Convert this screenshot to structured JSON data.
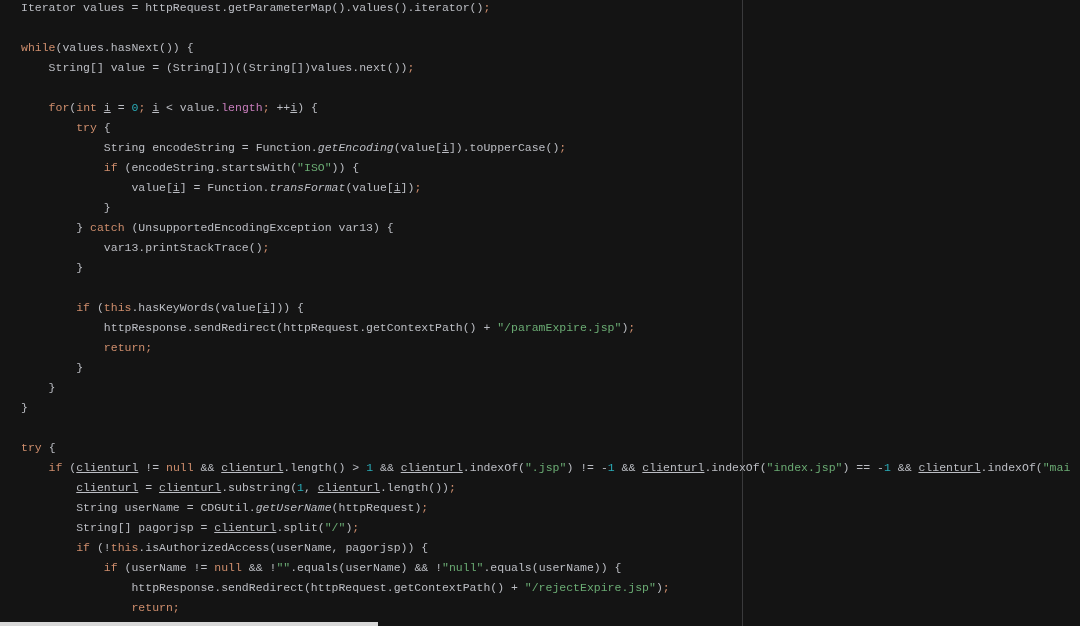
{
  "editor": {
    "lines": [
      {
        "kind": "code",
        "tokens": [
          {
            "kind": "plain",
            "t": "Iterator values = httpRequest.getParameterMap().values().iterator()"
          },
          {
            "kind": "keyword",
            "t": ";"
          }
        ]
      },
      {
        "kind": "blank"
      },
      {
        "kind": "code",
        "tokens": [
          {
            "kind": "keyword",
            "t": "while"
          },
          {
            "kind": "plain",
            "t": "(values.hasNext()) {"
          }
        ]
      },
      {
        "kind": "code",
        "tokens": [
          {
            "kind": "plain",
            "t": "    String[] value = (String[])((String[])values.next())"
          },
          {
            "kind": "keyword",
            "t": ";"
          }
        ]
      },
      {
        "kind": "blank"
      },
      {
        "kind": "code",
        "tokens": [
          {
            "kind": "keyword",
            "t": "    for"
          },
          {
            "kind": "plain",
            "t": "("
          },
          {
            "kind": "keyword",
            "t": "int "
          },
          {
            "kind": "variable",
            "t": "i"
          },
          {
            "kind": "plain",
            "t": " = "
          },
          {
            "kind": "number",
            "t": "0"
          },
          {
            "kind": "keyword",
            "t": "; "
          },
          {
            "kind": "variable",
            "t": "i"
          },
          {
            "kind": "plain",
            "t": " < value."
          },
          {
            "kind": "field",
            "t": "length"
          },
          {
            "kind": "keyword",
            "t": ";"
          },
          {
            "kind": "plain",
            "t": " ++"
          },
          {
            "kind": "variable",
            "t": "i"
          },
          {
            "kind": "plain",
            "t": ") {"
          }
        ]
      },
      {
        "kind": "code",
        "tokens": [
          {
            "kind": "keyword",
            "t": "        try"
          },
          {
            "kind": "plain",
            "t": " {"
          }
        ]
      },
      {
        "kind": "code",
        "tokens": [
          {
            "kind": "plain",
            "t": "            String encodeString = Function."
          },
          {
            "kind": "static",
            "t": "getEncoding"
          },
          {
            "kind": "plain",
            "t": "(value["
          },
          {
            "kind": "variable",
            "t": "i"
          },
          {
            "kind": "plain",
            "t": "]).toUpperCase()"
          },
          {
            "kind": "keyword",
            "t": ";"
          }
        ]
      },
      {
        "kind": "code",
        "tokens": [
          {
            "kind": "keyword",
            "t": "            if"
          },
          {
            "kind": "plain",
            "t": " (encodeString.startsWith("
          },
          {
            "kind": "string",
            "t": "\"ISO\""
          },
          {
            "kind": "plain",
            "t": ")) {"
          }
        ]
      },
      {
        "kind": "code",
        "tokens": [
          {
            "kind": "plain",
            "t": "                value["
          },
          {
            "kind": "variable",
            "t": "i"
          },
          {
            "kind": "plain",
            "t": "] = Function."
          },
          {
            "kind": "static",
            "t": "transFormat"
          },
          {
            "kind": "plain",
            "t": "(value["
          },
          {
            "kind": "variable",
            "t": "i"
          },
          {
            "kind": "plain",
            "t": "])"
          },
          {
            "kind": "keyword",
            "t": ";"
          }
        ]
      },
      {
        "kind": "code",
        "tokens": [
          {
            "kind": "plain",
            "t": "            }"
          }
        ]
      },
      {
        "kind": "code",
        "tokens": [
          {
            "kind": "plain",
            "t": "        } "
          },
          {
            "kind": "keyword",
            "t": "catch"
          },
          {
            "kind": "plain",
            "t": " (UnsupportedEncodingException var13) {"
          }
        ]
      },
      {
        "kind": "code",
        "tokens": [
          {
            "kind": "plain",
            "t": "            var13.printStackTrace()"
          },
          {
            "kind": "keyword",
            "t": ";"
          }
        ]
      },
      {
        "kind": "code",
        "tokens": [
          {
            "kind": "plain",
            "t": "        }"
          }
        ]
      },
      {
        "kind": "blank"
      },
      {
        "kind": "code",
        "tokens": [
          {
            "kind": "keyword",
            "t": "        if"
          },
          {
            "kind": "plain",
            "t": " ("
          },
          {
            "kind": "keyword",
            "t": "this"
          },
          {
            "kind": "plain",
            "t": ".hasKeyWords(value["
          },
          {
            "kind": "variable",
            "t": "i"
          },
          {
            "kind": "plain",
            "t": "])) {"
          }
        ]
      },
      {
        "kind": "code",
        "tokens": [
          {
            "kind": "plain",
            "t": "            httpResponse.sendRedirect(httpRequest.getContextPath() + "
          },
          {
            "kind": "string",
            "t": "\"/paramExpire.jsp\""
          },
          {
            "kind": "plain",
            "t": ")"
          },
          {
            "kind": "keyword",
            "t": ";"
          }
        ]
      },
      {
        "kind": "code",
        "tokens": [
          {
            "kind": "keyword",
            "t": "            return;"
          }
        ]
      },
      {
        "kind": "code",
        "tokens": [
          {
            "kind": "plain",
            "t": "        }"
          }
        ]
      },
      {
        "kind": "code",
        "tokens": [
          {
            "kind": "plain",
            "t": "    }"
          }
        ]
      },
      {
        "kind": "code",
        "tokens": [
          {
            "kind": "plain",
            "t": "}"
          }
        ]
      },
      {
        "kind": "blank"
      },
      {
        "kind": "code",
        "tokens": [
          {
            "kind": "keyword",
            "t": "try"
          },
          {
            "kind": "plain",
            "t": " {"
          }
        ]
      },
      {
        "kind": "code",
        "tokens": [
          {
            "kind": "keyword",
            "t": "    if"
          },
          {
            "kind": "plain",
            "t": " ("
          },
          {
            "kind": "variable",
            "t": "clienturl"
          },
          {
            "kind": "plain",
            "t": " != "
          },
          {
            "kind": "keyword",
            "t": "null"
          },
          {
            "kind": "plain",
            "t": " && "
          },
          {
            "kind": "variable",
            "t": "clienturl"
          },
          {
            "kind": "plain",
            "t": ".length() > "
          },
          {
            "kind": "number",
            "t": "1"
          },
          {
            "kind": "plain",
            "t": " && "
          },
          {
            "kind": "variable",
            "t": "clienturl"
          },
          {
            "kind": "plain",
            "t": ".indexOf("
          },
          {
            "kind": "string",
            "t": "\".jsp\""
          },
          {
            "kind": "plain",
            "t": ") != -"
          },
          {
            "kind": "number",
            "t": "1"
          },
          {
            "kind": "plain",
            "t": " && "
          },
          {
            "kind": "variable",
            "t": "clienturl"
          },
          {
            "kind": "plain",
            "t": ".indexOf("
          },
          {
            "kind": "string",
            "t": "\"index.jsp\""
          },
          {
            "kind": "plain",
            "t": ") == -"
          },
          {
            "kind": "number",
            "t": "1"
          },
          {
            "kind": "plain",
            "t": " && "
          },
          {
            "kind": "variable",
            "t": "clienturl"
          },
          {
            "kind": "plain",
            "t": ".indexOf("
          },
          {
            "kind": "string",
            "t": "\"mai"
          }
        ]
      },
      {
        "kind": "code",
        "tokens": [
          {
            "kind": "variable",
            "t": "        clienturl"
          },
          {
            "kind": "plain",
            "t": " = "
          },
          {
            "kind": "variable",
            "t": "clienturl"
          },
          {
            "kind": "plain",
            "t": ".substring("
          },
          {
            "kind": "number",
            "t": "1"
          },
          {
            "kind": "plain",
            "t": ", "
          },
          {
            "kind": "variable",
            "t": "clienturl"
          },
          {
            "kind": "plain",
            "t": ".length())"
          },
          {
            "kind": "keyword",
            "t": ";"
          }
        ]
      },
      {
        "kind": "code",
        "tokens": [
          {
            "kind": "plain",
            "t": "        String userName = CDGUtil."
          },
          {
            "kind": "static",
            "t": "getUserName"
          },
          {
            "kind": "plain",
            "t": "(httpRequest)"
          },
          {
            "kind": "keyword",
            "t": ";"
          }
        ]
      },
      {
        "kind": "code",
        "tokens": [
          {
            "kind": "plain",
            "t": "        String[] pagorjsp = "
          },
          {
            "kind": "variable",
            "t": "clienturl"
          },
          {
            "kind": "plain",
            "t": ".split("
          },
          {
            "kind": "string",
            "t": "\"/\""
          },
          {
            "kind": "plain",
            "t": ")"
          },
          {
            "kind": "keyword",
            "t": ";"
          }
        ]
      },
      {
        "kind": "code",
        "tokens": [
          {
            "kind": "keyword",
            "t": "        if"
          },
          {
            "kind": "plain",
            "t": " (!"
          },
          {
            "kind": "keyword",
            "t": "this"
          },
          {
            "kind": "plain",
            "t": ".isAuthorizedAccess(userName, pagorjsp)) {"
          }
        ]
      },
      {
        "kind": "code",
        "tokens": [
          {
            "kind": "keyword",
            "t": "            if"
          },
          {
            "kind": "plain",
            "t": " (userName != "
          },
          {
            "kind": "keyword",
            "t": "null"
          },
          {
            "kind": "plain",
            "t": " && !"
          },
          {
            "kind": "string",
            "t": "\"\""
          },
          {
            "kind": "plain",
            "t": ".equals(userName) && !"
          },
          {
            "kind": "string",
            "t": "\"null\""
          },
          {
            "kind": "plain",
            "t": ".equals(userName)) {"
          }
        ]
      },
      {
        "kind": "code",
        "tokens": [
          {
            "kind": "plain",
            "t": "                httpResponse.sendRedirect(httpRequest.getContextPath() + "
          },
          {
            "kind": "string",
            "t": "\"/rejectExpire.jsp\""
          },
          {
            "kind": "plain",
            "t": ")"
          },
          {
            "kind": "keyword",
            "t": ";"
          }
        ]
      },
      {
        "kind": "code",
        "tokens": [
          {
            "kind": "keyword",
            "t": "                return;"
          }
        ]
      }
    ]
  }
}
